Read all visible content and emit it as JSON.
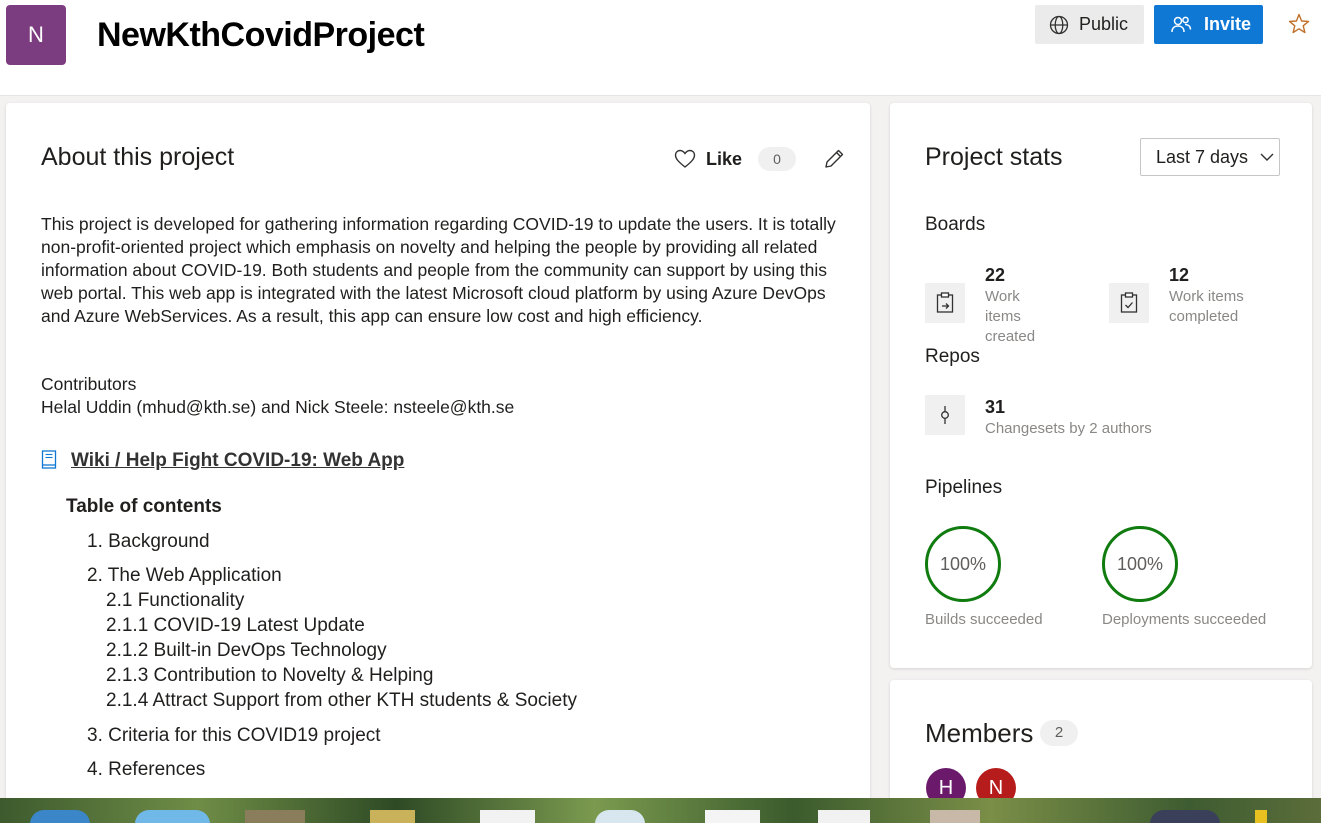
{
  "header": {
    "avatar_letter": "N",
    "project_name": "NewKthCovidProject",
    "public_label": "Public",
    "invite_label": "Invite",
    "favorite_icon": "star-icon",
    "colors": {
      "avatar": "#7c3c80",
      "invite": "#0f78d4"
    }
  },
  "about": {
    "title": "About this project",
    "like_label": "Like",
    "like_count": "0",
    "description": "This project is developed for gathering information regarding COVID-19 to update the users. It is totally non-profit-oriented project which emphasis on novelty and helping the people by providing all related information about COVID-19. Both students and people from the community can support by using this web portal. This web app is integrated with the latest Microsoft cloud platform by using Azure DevOps and Azure WebServices. As a result, this app can ensure low cost and high efficiency.",
    "contributors_label": "Contributors",
    "contributors_text": "Helal Uddin (mhud@kth.se) and Nick Steele: nsteele@kth.se",
    "wiki_link": "Wiki / Help Fight COVID-19: Web App",
    "toc_title": "Table of contents",
    "toc": [
      "1. Background",
      "2. The Web Application",
      "2.1 Functionality",
      "2.1.1 COVID-19 Latest Update",
      "2.1.2 Built-in DevOps Technology",
      "2.1.3 Contribution to Novelty & Helping",
      "2.1.4 Attract Support from other KTH students & Society",
      "3. Criteria for this COVID19 project",
      "4. References"
    ]
  },
  "stats": {
    "title": "Project stats",
    "period": "Last 7 days",
    "boards": {
      "label": "Boards",
      "created_count": "22",
      "created_text": "Work items created",
      "completed_count": "12",
      "completed_text": "Work items completed"
    },
    "repos": {
      "label": "Repos",
      "changesets_count": "31",
      "changesets_text": "Changesets by 2 authors"
    },
    "pipelines": {
      "label": "Pipelines",
      "builds_percent": "100%",
      "builds_text": "Builds succeeded",
      "deployments_percent": "100%",
      "deployments_text": "Deployments succeeded",
      "success_color": "#107c10"
    }
  },
  "members": {
    "title": "Members",
    "count": "2",
    "avatars": [
      {
        "letter": "H",
        "color": "#6b1a6b"
      },
      {
        "letter": "N",
        "color": "#b71c1c"
      }
    ]
  }
}
